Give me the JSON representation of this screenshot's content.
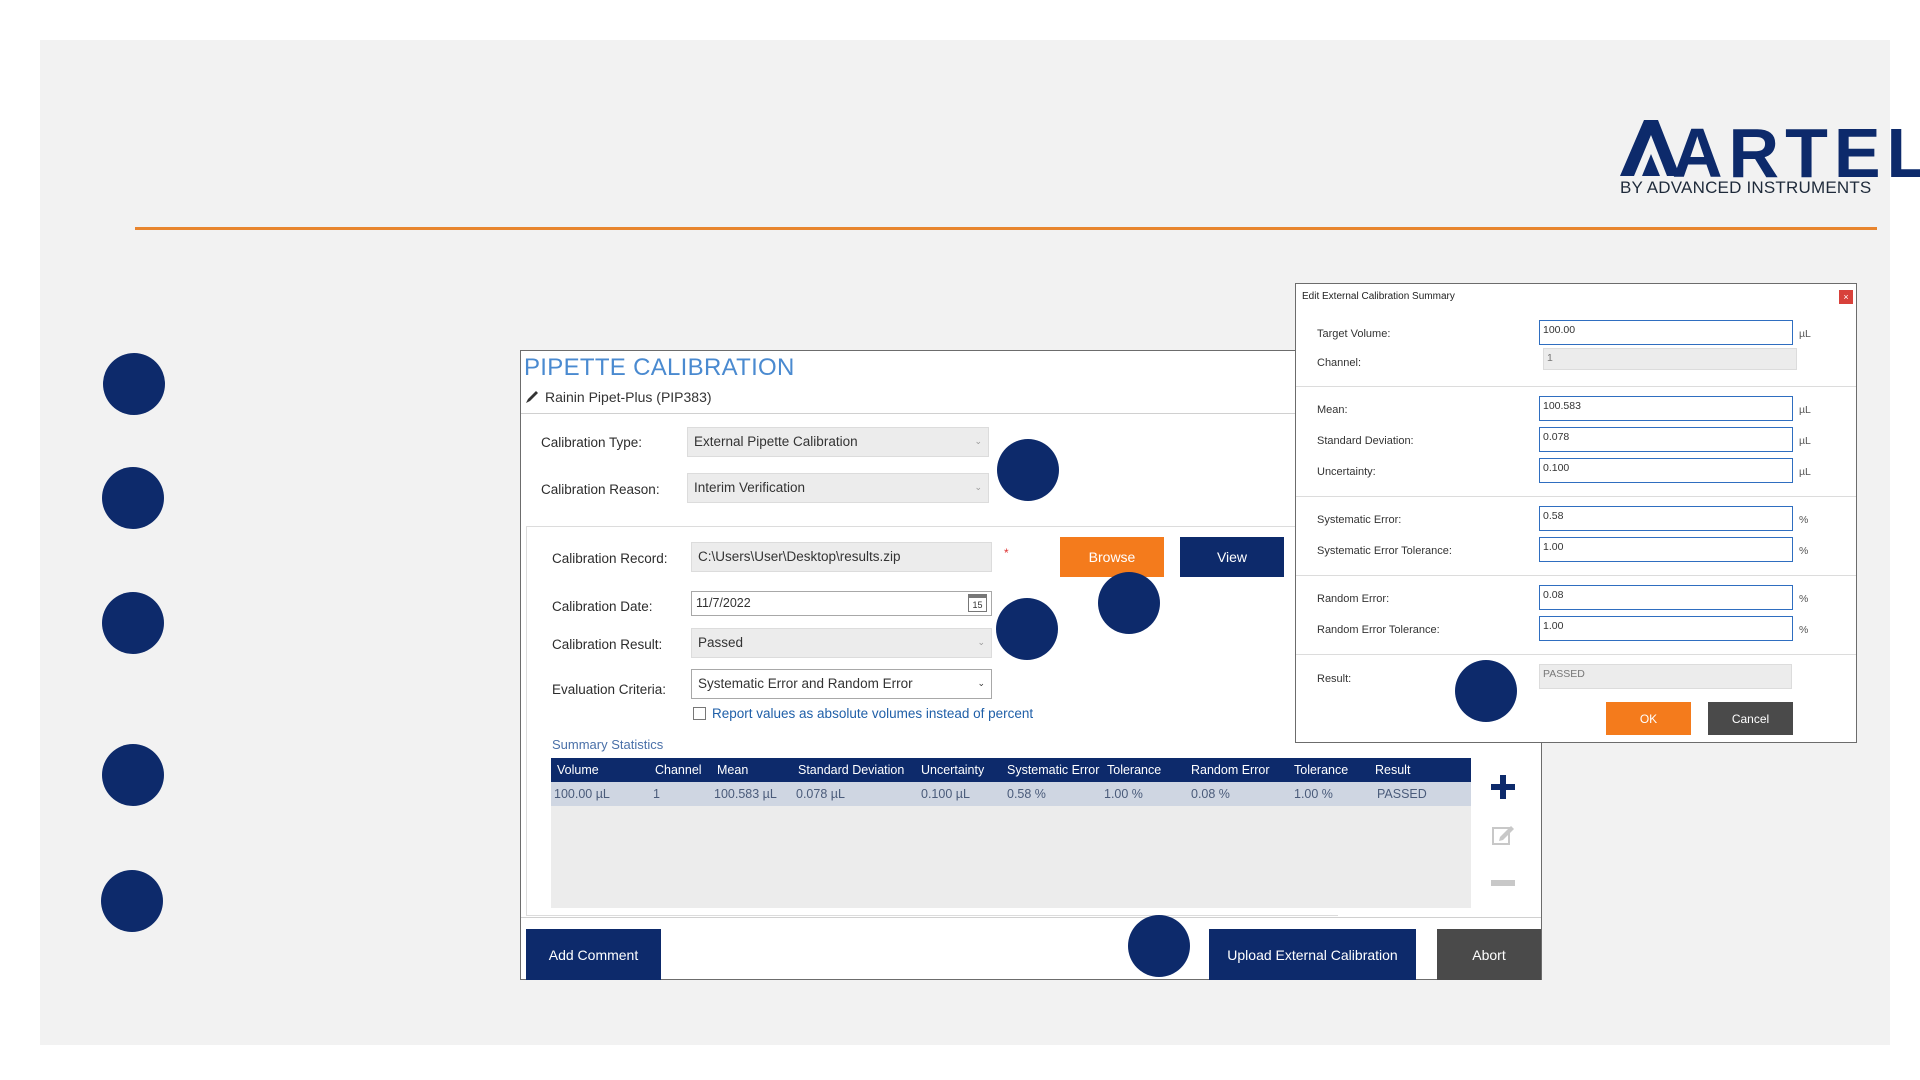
{
  "brand": {
    "name": "ARTEL",
    "tagline": "BY ADVANCED INSTRUMENTS",
    "navy": "#0d2a6b",
    "orange": "#f47b1c",
    "rule_color": "#e8852e"
  },
  "main": {
    "title": "PIPETTE CALIBRATION",
    "subtitle": "Rainin Pipet-Plus (PIP383)",
    "calibration_type_label": "Calibration Type:",
    "calibration_type_value": "External Pipette Calibration",
    "calibration_reason_label": "Calibration Reason:",
    "calibration_reason_value": "Interim Verification",
    "calibration_record_label": "Calibration Record:",
    "calibration_record_value": "C:\\Users\\User\\Desktop\\results.zip",
    "required_mark": "*",
    "browse_label": "Browse",
    "view_label": "View",
    "calibration_date_label": "Calibration Date:",
    "calibration_date_value": "11/7/2022",
    "calendar_day": "15",
    "calibration_result_label": "Calibration Result:",
    "calibration_result_value": "Passed",
    "evaluation_criteria_label": "Evaluation Criteria:",
    "evaluation_criteria_value": "Systematic Error and Random Error",
    "absolute_volumes_label": "Report values as absolute volumes instead of percent",
    "summary_label": "Summary Statistics",
    "table": {
      "columns": [
        "Volume",
        "Channel",
        "Mean",
        "Standard Deviation",
        "Uncertainty",
        "Systematic Error",
        "Tolerance",
        "Random Error",
        "Tolerance",
        "Result"
      ],
      "rows": [
        [
          "100.00 µL",
          "1",
          "100.583 µL",
          "0.078 µL",
          "0.100 µL",
          "0.58 %",
          "1.00 %",
          "0.08 %",
          "1.00 %",
          "PASSED"
        ]
      ]
    },
    "add_comment_label": "Add Comment",
    "upload_label": "Upload External Calibration",
    "abort_label": "Abort"
  },
  "dialog": {
    "title": "Edit External Calibration Summary",
    "close_glyph": "×",
    "target_volume_label": "Target Volume:",
    "target_volume_value": "100.00",
    "channel_label": "Channel:",
    "channel_value": "1",
    "mean_label": "Mean:",
    "mean_value": "100.583",
    "std_dev_label": "Standard Deviation:",
    "std_dev_value": "0.078",
    "uncertainty_label": "Uncertainty:",
    "uncertainty_value": "0.100",
    "systematic_error_label": "Systematic Error:",
    "systematic_error_value": "0.58",
    "systematic_tol_label": "Systematic Error Tolerance:",
    "systematic_tol_value": "1.00",
    "random_error_label": "Random Error:",
    "random_error_value": "0.08",
    "random_tol_label": "Random Error Tolerance:",
    "random_tol_value": "1.00",
    "result_label": "Result:",
    "result_value": "PASSED",
    "unit_ul": "µL",
    "unit_pct": "%",
    "ok_label": "OK",
    "cancel_label": "Cancel"
  }
}
